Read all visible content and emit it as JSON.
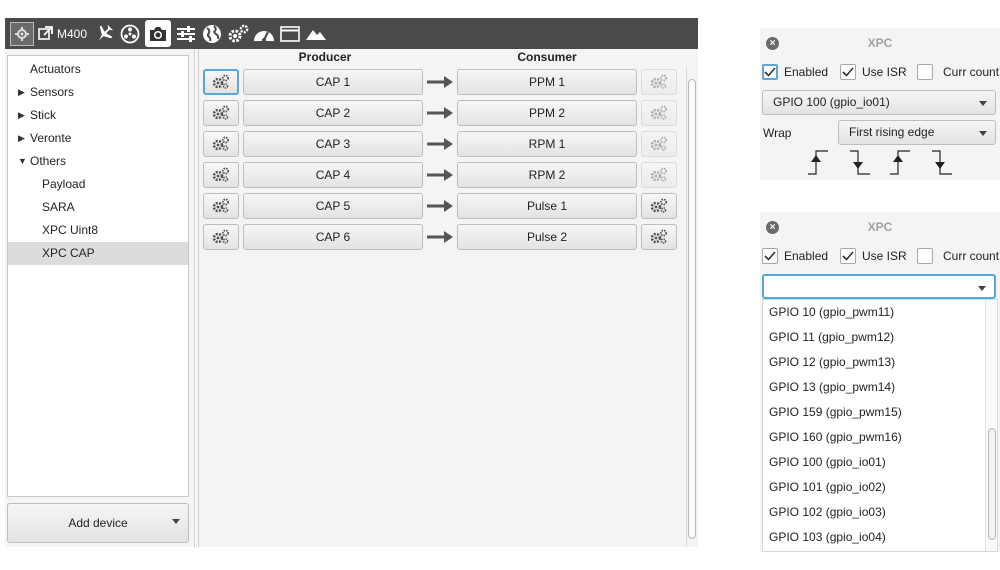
{
  "toolbar": {
    "device_label": "M400",
    "icons": [
      "grid-icon",
      "external-link-icon",
      "airplane-icon",
      "radiation-icon",
      "camera-icon",
      "sliders-icon",
      "globe-icon",
      "gears-icon",
      "dashboard-icon",
      "window-icon",
      "mountains-icon"
    ],
    "active_icon": "camera-icon"
  },
  "sidebar": {
    "items": [
      {
        "label": "Actuators",
        "indent": 0,
        "arrow": ""
      },
      {
        "label": "Sensors",
        "indent": 0,
        "arrow": "▶"
      },
      {
        "label": "Stick",
        "indent": 0,
        "arrow": "▶"
      },
      {
        "label": "Veronte",
        "indent": 0,
        "arrow": "▶"
      },
      {
        "label": "Others",
        "indent": 0,
        "arrow": "▼"
      },
      {
        "label": "Payload",
        "indent": 1,
        "arrow": ""
      },
      {
        "label": "SARA",
        "indent": 1,
        "arrow": ""
      },
      {
        "label": "XPC Uint8",
        "indent": 1,
        "arrow": ""
      },
      {
        "label": "XPC CAP",
        "indent": 1,
        "arrow": "",
        "selected": true
      }
    ],
    "add_device_label": "Add device"
  },
  "mapping": {
    "producer_header": "Producer",
    "consumer_header": "Consumer",
    "rows": [
      {
        "producer": "CAP 1",
        "consumer": "PPM 1",
        "consumer_config_enabled": false
      },
      {
        "producer": "CAP 2",
        "consumer": "PPM 2",
        "consumer_config_enabled": false
      },
      {
        "producer": "CAP 3",
        "consumer": "RPM 1",
        "consumer_config_enabled": false
      },
      {
        "producer": "CAP 4",
        "consumer": "RPM 2",
        "consumer_config_enabled": false
      },
      {
        "producer": "CAP 5",
        "consumer": "Pulse 1",
        "consumer_config_enabled": true
      },
      {
        "producer": "CAP 6",
        "consumer": "Pulse 2",
        "consumer_config_enabled": true
      }
    ]
  },
  "xpc_top": {
    "title": "XPC",
    "enabled_label": "Enabled",
    "enabled": true,
    "use_isr_label": "Use ISR",
    "use_isr": true,
    "curr_count_label": "Curr count",
    "curr_count": false,
    "gpio_value": "GPIO 100 (gpio_io01)",
    "wrap_label": "Wrap",
    "wrap_value": "First rising edge",
    "edge_icons": [
      "rising-edge-icon",
      "falling-edge-icon",
      "rising-edge-icon",
      "falling-edge-icon"
    ]
  },
  "xpc_bottom": {
    "title": "XPC",
    "enabled_label": "Enabled",
    "enabled": true,
    "use_isr_label": "Use ISR",
    "use_isr": true,
    "curr_count_label": "Curr count",
    "curr_count": false,
    "gpio_value": "",
    "gpio_options": [
      "GPIO 10 (gpio_pwm11)",
      "GPIO 11 (gpio_pwm12)",
      "GPIO 12 (gpio_pwm13)",
      "GPIO 13 (gpio_pwm14)",
      "GPIO 159 (gpio_pwm15)",
      "GPIO 160 (gpio_pwm16)",
      "GPIO 100 (gpio_io01)",
      "GPIO 101 (gpio_io02)",
      "GPIO 102 (gpio_io03)",
      "GPIO 103 (gpio_io04)"
    ]
  },
  "colors": {
    "toolbar_bg": "#4a4a4a",
    "focus_blue": "#57a7d8",
    "panel_bg": "#f4f4f4"
  }
}
